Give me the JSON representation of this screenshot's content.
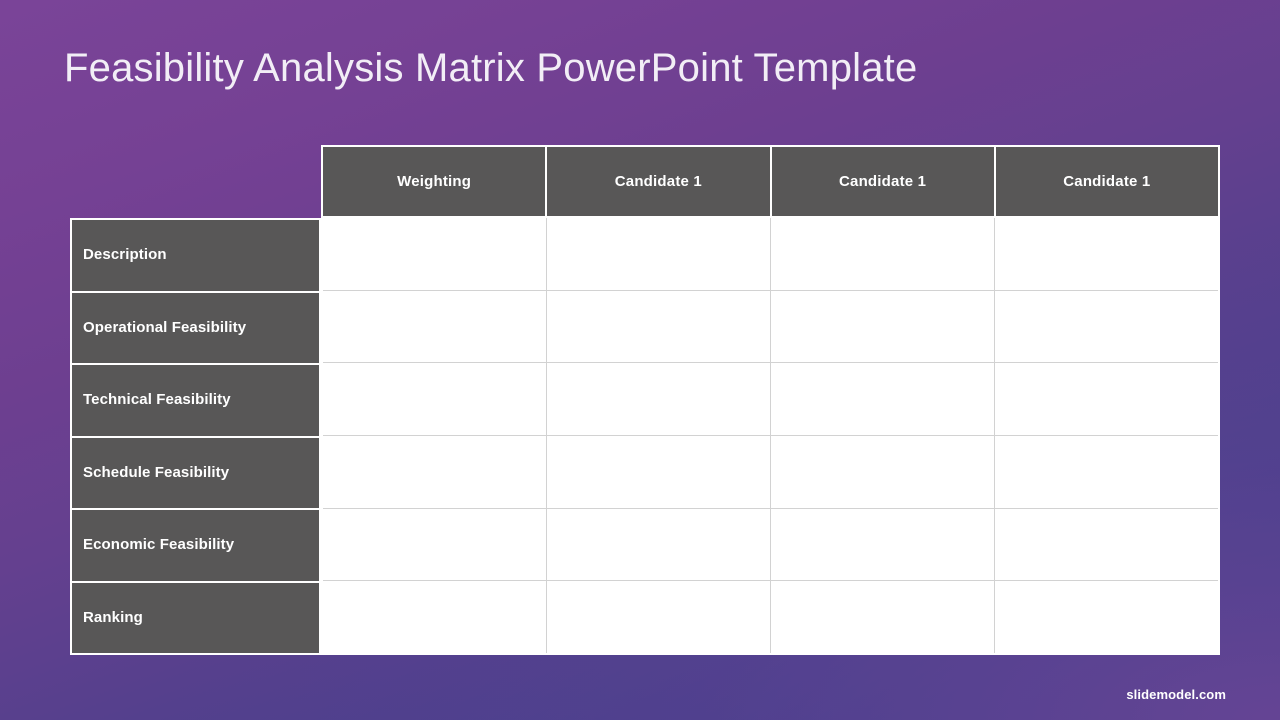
{
  "slide": {
    "title": "Feasibility Analysis Matrix PowerPoint Template",
    "brand": "slidemodel.com",
    "colors": {
      "bg_top": "#7a4498",
      "bg_bottom": "#3b3c8a",
      "header_fill": "#585757",
      "label_fill": "#585757",
      "cell_fill": "#ffffff",
      "grid_line": "#d2d2d2",
      "outline": "#ffffff",
      "title_text": "#f2eef6"
    }
  },
  "matrix": {
    "corner_label": "",
    "columns": [
      {
        "label": "Weighting"
      },
      {
        "label": "Candidate 1"
      },
      {
        "label": "Candidate 1"
      },
      {
        "label": "Candidate 1"
      }
    ],
    "rows": [
      {
        "label": "Description",
        "cells": [
          "",
          "",
          "",
          ""
        ]
      },
      {
        "label": "Operational Feasibility",
        "cells": [
          "",
          "",
          "",
          ""
        ]
      },
      {
        "label": "Technical Feasibility",
        "cells": [
          "",
          "",
          "",
          ""
        ]
      },
      {
        "label": "Schedule Feasibility",
        "cells": [
          "",
          "",
          "",
          ""
        ]
      },
      {
        "label": "Economic Feasibility",
        "cells": [
          "",
          "",
          "",
          ""
        ]
      },
      {
        "label": "Ranking",
        "cells": [
          "",
          "",
          "",
          ""
        ]
      }
    ]
  }
}
